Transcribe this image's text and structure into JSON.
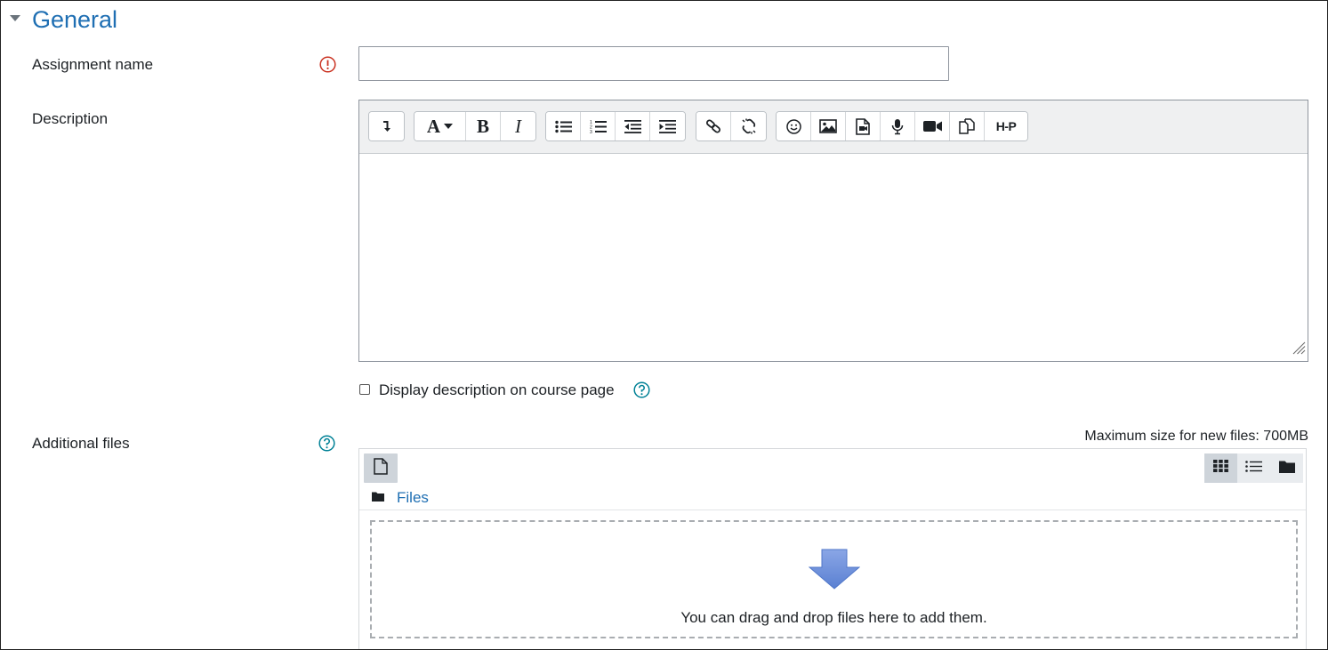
{
  "section": {
    "title": "General"
  },
  "fields": {
    "assignment_name": {
      "label": "Assignment name",
      "value": "",
      "placeholder": ""
    },
    "description": {
      "label": "Description"
    },
    "display_description": {
      "label": "Display description on course page",
      "checked": false
    },
    "additional_files": {
      "label": "Additional files"
    }
  },
  "editor": {
    "toolbar": [
      [
        "more-toggle"
      ],
      [
        "font-style",
        "bold",
        "italic"
      ],
      [
        "unordered-list",
        "ordered-list",
        "outdent",
        "indent"
      ],
      [
        "link",
        "unlink"
      ],
      [
        "emoji",
        "image",
        "media",
        "record-audio",
        "record-video",
        "manage-files",
        "h5p"
      ]
    ],
    "labels": {
      "font_style": "A",
      "bold": "B",
      "italic": "I",
      "h5p": "H-P"
    }
  },
  "filemanager": {
    "max_size": "Maximum size for new files: 700MB",
    "path_label": "Files",
    "drop_text": "You can drag and drop files here to add them.",
    "active_view": "icons"
  },
  "colors": {
    "link": "#1f6fb3",
    "required": "#ca3120",
    "help": "#008196",
    "drop_arrow": "#6b8ed6"
  }
}
